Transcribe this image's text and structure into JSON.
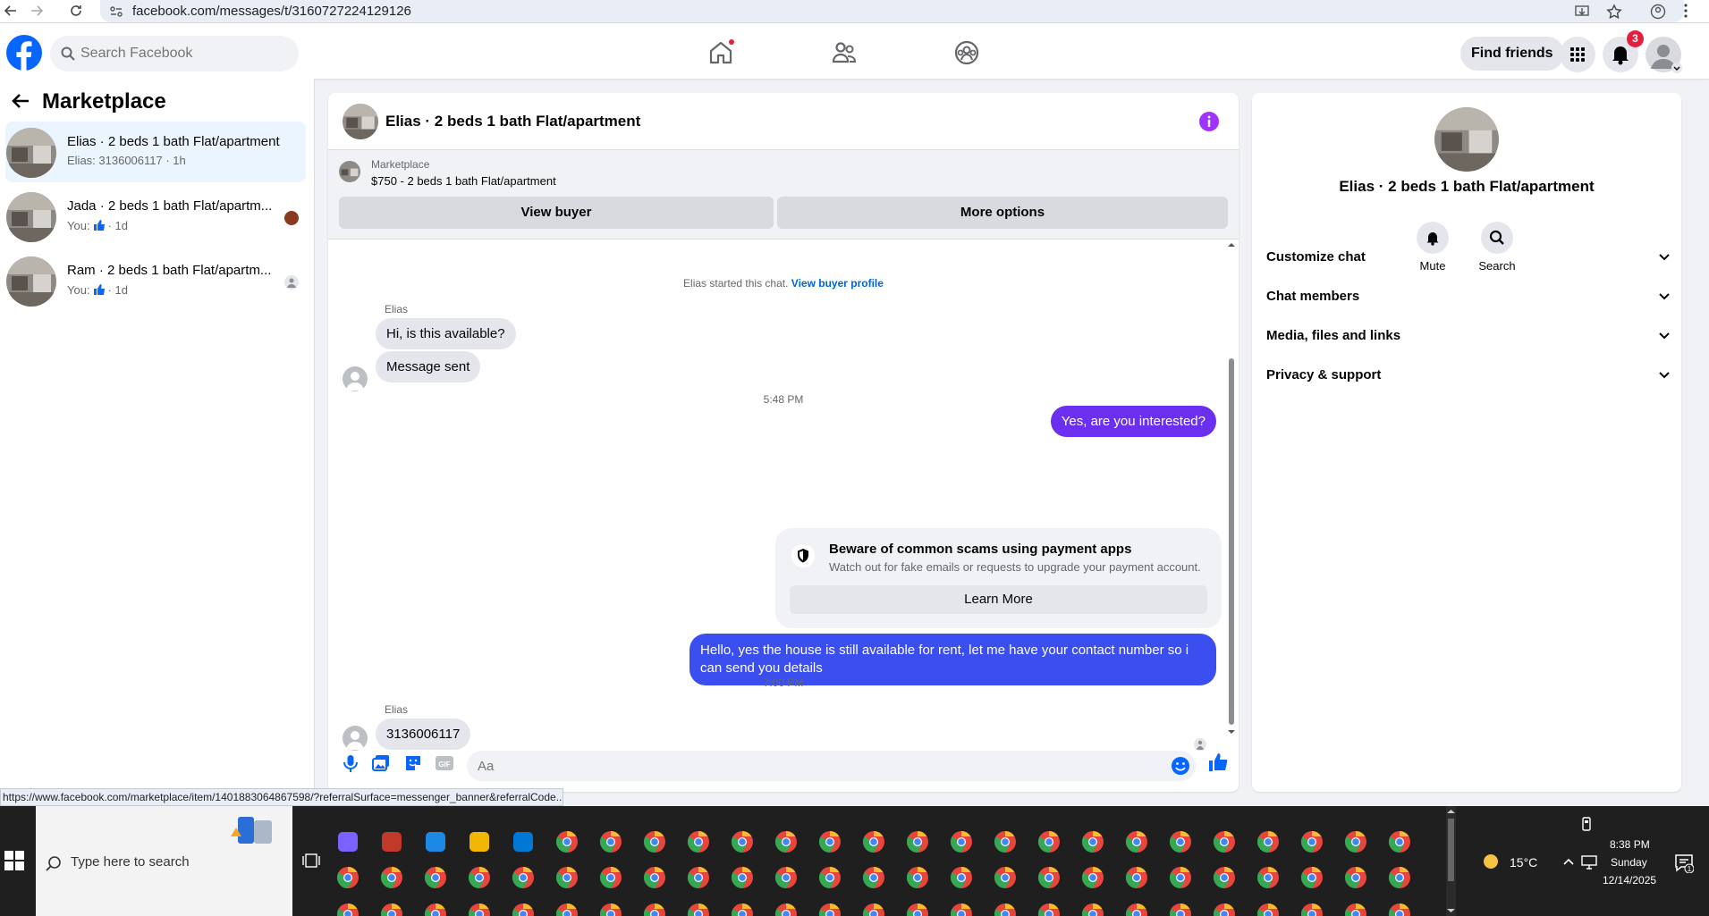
{
  "browser": {
    "url": "facebook.com/messages/t/3160727224129126"
  },
  "header": {
    "search_placeholder": "Search Facebook",
    "find_friends": "Find friends",
    "notification_count": "3"
  },
  "sidebar": {
    "title": "Marketplace",
    "conversations": [
      {
        "name": "Elias · 2 beds 1 bath Flat/apartment",
        "preview": "Elias: 3136006117 · 1h",
        "active": true
      },
      {
        "name": "Jada · 2 beds 1 bath Flat/apartm...",
        "you": "You:",
        "time": "· 1d"
      },
      {
        "name": "Ram · 2 beds 1 bath Flat/apartm...",
        "you": "You:",
        "time": "· 1d"
      }
    ]
  },
  "chat": {
    "title": "Elias · 2 beds 1 bath Flat/apartment",
    "marketplace_label": "Marketplace",
    "listing": "$750 - 2 beds 1 bath Flat/apartment",
    "view_buyer": "View buyer",
    "more_options": "More options",
    "started": "Elias started this chat.",
    "view_buyer_profile": "View buyer profile",
    "sender1": "Elias",
    "msg1": "Hi, is this available?",
    "msg2": "Message sent",
    "time1": "5:48 PM",
    "out1": "Yes, are you interested?",
    "scam_title": "Beware of common scams using payment apps",
    "scam_desc": "Watch out for fake emails or requests to upgrade your payment account.",
    "learn_more": "Learn More",
    "out2": "Hello, yes the house is still available for rent, let me have your contact number so i can send you details",
    "time2": "7:00 PM",
    "sender2": "Elias",
    "msg3": "3136006117",
    "composer_placeholder": "Aa"
  },
  "details": {
    "title": "Elias · 2 beds 1 bath Flat/apartment",
    "mute": "Mute",
    "search": "Search",
    "sections": [
      "Customize chat",
      "Chat members",
      "Media, files and links",
      "Privacy & support"
    ]
  },
  "status_url": "https://www.facebook.com/marketplace/item/1401883064867598/?referralSurface=messenger_banner&referralCode...",
  "taskbar": {
    "search_placeholder": "Type here to search",
    "weather": "15°C",
    "time": "8:38 PM",
    "day": "Sunday",
    "date": "12/14/2025",
    "notif_count": "1"
  },
  "colors": {
    "fb_blue": "#0866ff",
    "outgoing": "#6b2fef",
    "outgoing2": "#3b4ef0"
  }
}
